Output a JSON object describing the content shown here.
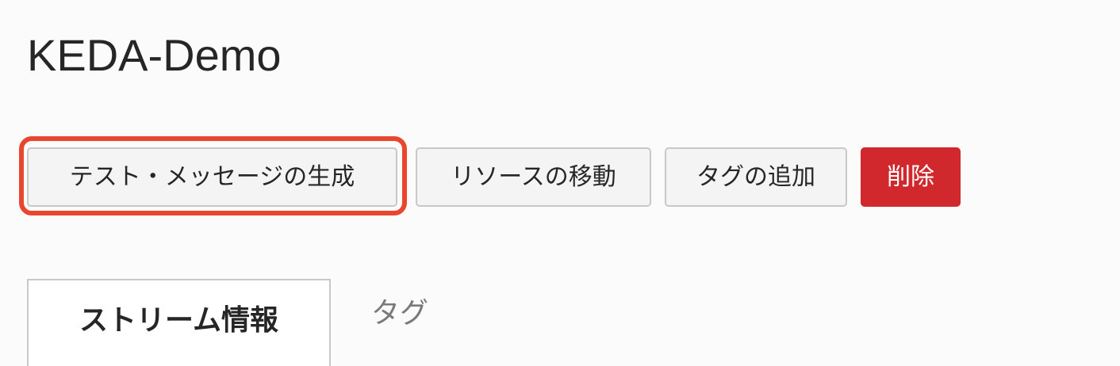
{
  "header": {
    "title": "KEDA-Demo"
  },
  "actions": {
    "test_message_label": "テスト・メッセージの生成",
    "move_resource_label": "リソースの移動",
    "add_tag_label": "タグの追加",
    "delete_label": "削除"
  },
  "tabs": [
    {
      "label": "ストリーム情報",
      "active": true
    },
    {
      "label": "タグ",
      "active": false
    }
  ],
  "colors": {
    "delete_background": "#d0282c",
    "highlight_outline": "#e8472e",
    "page_background": "#fbfbfb"
  }
}
